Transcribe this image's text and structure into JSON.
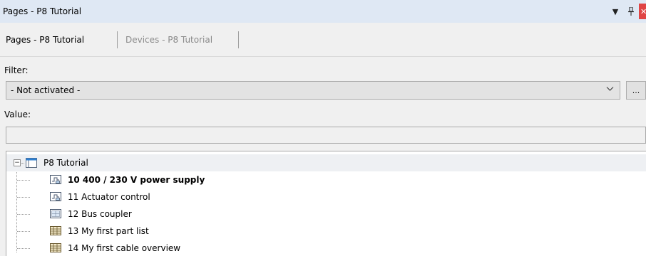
{
  "window": {
    "title": "Pages - P8 Tutorial",
    "pin_glyph": "▾ 1",
    "close_glyph": "✕"
  },
  "tabs": [
    {
      "label": "Pages - P8 Tutorial",
      "active": true
    },
    {
      "label": "Devices - P8 Tutorial",
      "active": false
    }
  ],
  "filter": {
    "label": "Filter:",
    "selected": "- Not activated -",
    "more_button": "..."
  },
  "value": {
    "label": "Value:",
    "current": ""
  },
  "tree": {
    "root": {
      "label": "P8 Tutorial",
      "expander": "−"
    },
    "items": [
      {
        "label": "10 400 / 230 V power supply",
        "icon": "schematic-page-icon",
        "bold": true
      },
      {
        "label": "11 Actuator control",
        "icon": "schematic-page-icon",
        "bold": false
      },
      {
        "label": "12 Bus coupler",
        "icon": "graphic-page-icon",
        "bold": false
      },
      {
        "label": "13 My first part list",
        "icon": "list-page-icon",
        "bold": false
      },
      {
        "label": "14 My first cable overview",
        "icon": "list-page-icon",
        "bold": false
      }
    ]
  },
  "colors": {
    "titlebar": "#dfe8f4",
    "close": "#e04545",
    "tree_selection": "#eef0f3"
  }
}
